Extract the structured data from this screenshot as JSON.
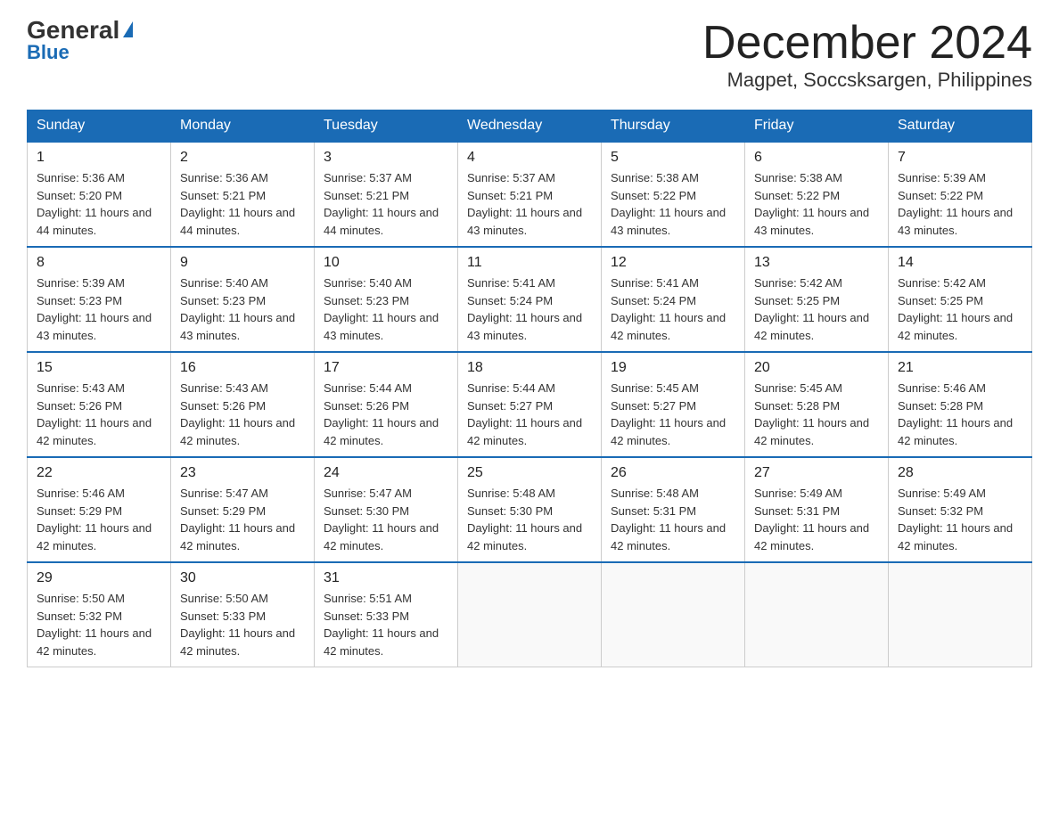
{
  "logo": {
    "general": "General",
    "blue": "Blue"
  },
  "title": "December 2024",
  "location": "Magpet, Soccsksargen, Philippines",
  "weekdays": [
    "Sunday",
    "Monday",
    "Tuesday",
    "Wednesday",
    "Thursday",
    "Friday",
    "Saturday"
  ],
  "weeks": [
    [
      {
        "day": "1",
        "sunrise": "5:36 AM",
        "sunset": "5:20 PM",
        "daylight": "11 hours and 44 minutes."
      },
      {
        "day": "2",
        "sunrise": "5:36 AM",
        "sunset": "5:21 PM",
        "daylight": "11 hours and 44 minutes."
      },
      {
        "day": "3",
        "sunrise": "5:37 AM",
        "sunset": "5:21 PM",
        "daylight": "11 hours and 44 minutes."
      },
      {
        "day": "4",
        "sunrise": "5:37 AM",
        "sunset": "5:21 PM",
        "daylight": "11 hours and 43 minutes."
      },
      {
        "day": "5",
        "sunrise": "5:38 AM",
        "sunset": "5:22 PM",
        "daylight": "11 hours and 43 minutes."
      },
      {
        "day": "6",
        "sunrise": "5:38 AM",
        "sunset": "5:22 PM",
        "daylight": "11 hours and 43 minutes."
      },
      {
        "day": "7",
        "sunrise": "5:39 AM",
        "sunset": "5:22 PM",
        "daylight": "11 hours and 43 minutes."
      }
    ],
    [
      {
        "day": "8",
        "sunrise": "5:39 AM",
        "sunset": "5:23 PM",
        "daylight": "11 hours and 43 minutes."
      },
      {
        "day": "9",
        "sunrise": "5:40 AM",
        "sunset": "5:23 PM",
        "daylight": "11 hours and 43 minutes."
      },
      {
        "day": "10",
        "sunrise": "5:40 AM",
        "sunset": "5:23 PM",
        "daylight": "11 hours and 43 minutes."
      },
      {
        "day": "11",
        "sunrise": "5:41 AM",
        "sunset": "5:24 PM",
        "daylight": "11 hours and 43 minutes."
      },
      {
        "day": "12",
        "sunrise": "5:41 AM",
        "sunset": "5:24 PM",
        "daylight": "11 hours and 42 minutes."
      },
      {
        "day": "13",
        "sunrise": "5:42 AM",
        "sunset": "5:25 PM",
        "daylight": "11 hours and 42 minutes."
      },
      {
        "day": "14",
        "sunrise": "5:42 AM",
        "sunset": "5:25 PM",
        "daylight": "11 hours and 42 minutes."
      }
    ],
    [
      {
        "day": "15",
        "sunrise": "5:43 AM",
        "sunset": "5:26 PM",
        "daylight": "11 hours and 42 minutes."
      },
      {
        "day": "16",
        "sunrise": "5:43 AM",
        "sunset": "5:26 PM",
        "daylight": "11 hours and 42 minutes."
      },
      {
        "day": "17",
        "sunrise": "5:44 AM",
        "sunset": "5:26 PM",
        "daylight": "11 hours and 42 minutes."
      },
      {
        "day": "18",
        "sunrise": "5:44 AM",
        "sunset": "5:27 PM",
        "daylight": "11 hours and 42 minutes."
      },
      {
        "day": "19",
        "sunrise": "5:45 AM",
        "sunset": "5:27 PM",
        "daylight": "11 hours and 42 minutes."
      },
      {
        "day": "20",
        "sunrise": "5:45 AM",
        "sunset": "5:28 PM",
        "daylight": "11 hours and 42 minutes."
      },
      {
        "day": "21",
        "sunrise": "5:46 AM",
        "sunset": "5:28 PM",
        "daylight": "11 hours and 42 minutes."
      }
    ],
    [
      {
        "day": "22",
        "sunrise": "5:46 AM",
        "sunset": "5:29 PM",
        "daylight": "11 hours and 42 minutes."
      },
      {
        "day": "23",
        "sunrise": "5:47 AM",
        "sunset": "5:29 PM",
        "daylight": "11 hours and 42 minutes."
      },
      {
        "day": "24",
        "sunrise": "5:47 AM",
        "sunset": "5:30 PM",
        "daylight": "11 hours and 42 minutes."
      },
      {
        "day": "25",
        "sunrise": "5:48 AM",
        "sunset": "5:30 PM",
        "daylight": "11 hours and 42 minutes."
      },
      {
        "day": "26",
        "sunrise": "5:48 AM",
        "sunset": "5:31 PM",
        "daylight": "11 hours and 42 minutes."
      },
      {
        "day": "27",
        "sunrise": "5:49 AM",
        "sunset": "5:31 PM",
        "daylight": "11 hours and 42 minutes."
      },
      {
        "day": "28",
        "sunrise": "5:49 AM",
        "sunset": "5:32 PM",
        "daylight": "11 hours and 42 minutes."
      }
    ],
    [
      {
        "day": "29",
        "sunrise": "5:50 AM",
        "sunset": "5:32 PM",
        "daylight": "11 hours and 42 minutes."
      },
      {
        "day": "30",
        "sunrise": "5:50 AM",
        "sunset": "5:33 PM",
        "daylight": "11 hours and 42 minutes."
      },
      {
        "day": "31",
        "sunrise": "5:51 AM",
        "sunset": "5:33 PM",
        "daylight": "11 hours and 42 minutes."
      },
      null,
      null,
      null,
      null
    ]
  ]
}
